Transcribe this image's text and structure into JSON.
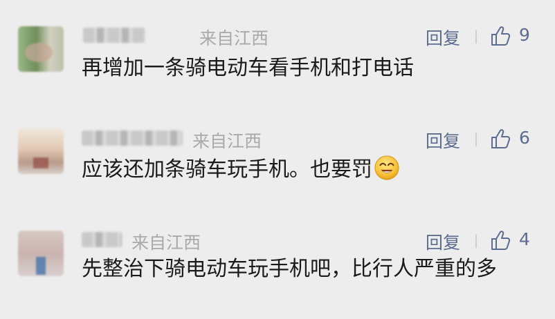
{
  "comments": [
    {
      "origin": "来自江西",
      "reply_label": "回复",
      "likes": "9",
      "text": "再增加一条骑电动车看手机和打电话",
      "emoji": null
    },
    {
      "origin": "来自江西",
      "reply_label": "回复",
      "likes": "6",
      "text": "应该还加条骑车玩手机。也要罚",
      "emoji": "smile-emoji"
    },
    {
      "origin": "来自江西",
      "reply_label": "回复",
      "likes": "4",
      "text": "先整治下骑电动车玩手机吧，比行人严重的多",
      "emoji": null
    }
  ],
  "icons": {
    "like": "thumbs-up-icon"
  },
  "colors": {
    "background": "#ededed",
    "link": "#5d6c8e",
    "meta": "#a9a9a9",
    "text": "#1a1a1a"
  }
}
